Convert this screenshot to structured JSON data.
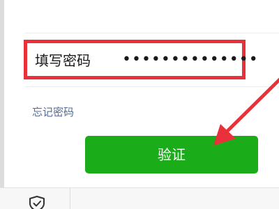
{
  "password_field": {
    "label": "填写密码",
    "value": "••••••••••••••"
  },
  "forgot_password": {
    "label": "忘记密码"
  },
  "verify_button": {
    "label": "验证"
  },
  "colors": {
    "highlight_border": "#e8313a",
    "arrow": "#e8313a",
    "button_green": "#1aad19",
    "link_blue": "#576b95"
  },
  "icons": {
    "bottom_left": "shield-check-icon",
    "annotation": "red-arrow-icon"
  }
}
